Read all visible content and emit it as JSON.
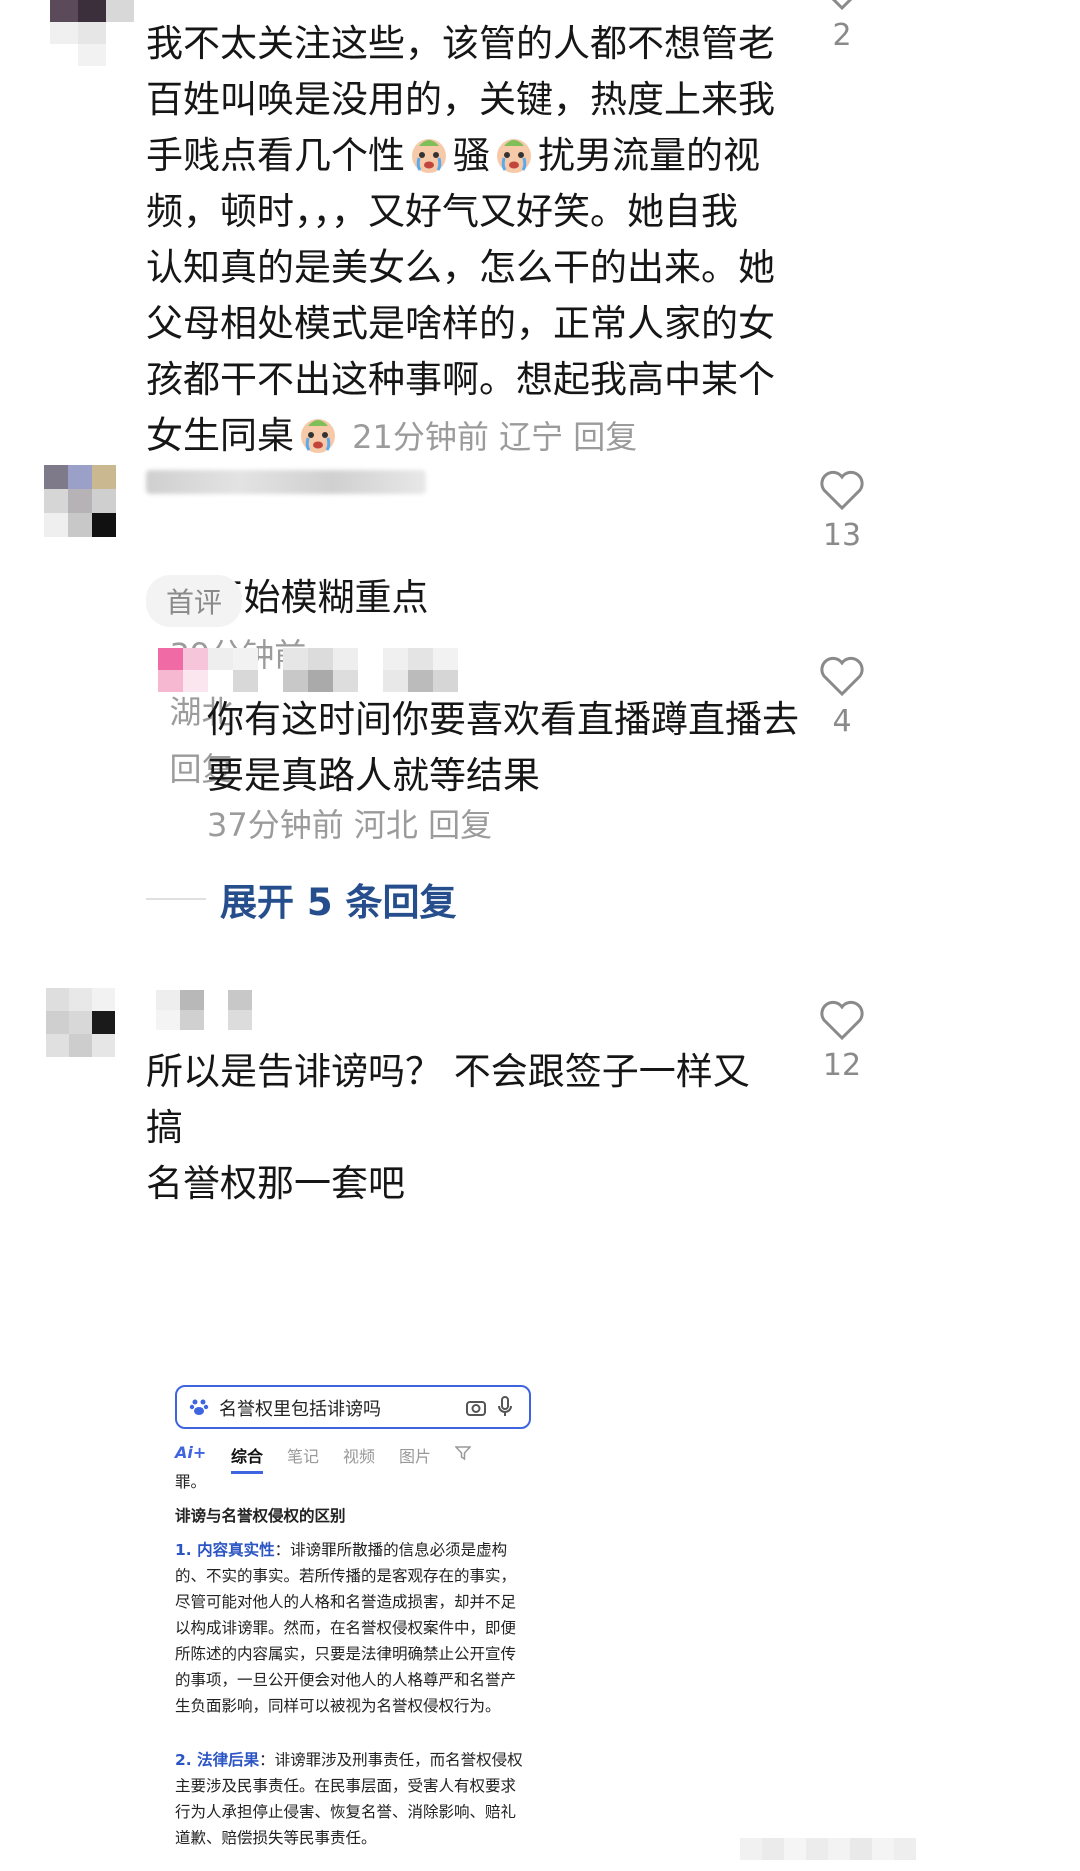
{
  "comments": [
    {
      "text": "我不太关注这些，该管的人都不想管老\n百姓叫唤是没用的，关键，热度上来我\n手贱点看几个性{e}骚{e}扰男流量的视\n频，顿时，，，又好气又好笑。她自我\n认知真的是美女么，怎么干的出来。她\n父母相处模式是啥样的，正常人家的女\n孩都干不出这种事啊。想起我高中某个\n女生同桌{e}",
      "time": "21分钟前",
      "region": "辽宁",
      "reply": "回复",
      "likes": "2"
    },
    {
      "text": "又开始模糊重点",
      "time": "39分钟前",
      "region": "湖北",
      "reply": "回复",
      "likes": "13",
      "tag": "首评"
    },
    {
      "text": "你有这时间你要喜欢看直播蹲直播去\n要是真路人就等结果",
      "time": "37分钟前",
      "region": "河北",
      "reply": "回复",
      "likes": "4"
    },
    {
      "text": "所以是告诽谤吗？ 不会跟签子一样又搞\n名誉权那一套吧",
      "likes": "12"
    }
  ],
  "expand_replies": "展开 5 条回复",
  "embedded": {
    "query": "名誉权里包括诽谤吗",
    "tabs": [
      "Ai+",
      "综合",
      "笔记",
      "视频",
      "图片"
    ],
    "lead": "罪。",
    "heading": "诽谤与名誉权侵权的区别",
    "p1_label": "1. 内容真实性",
    "p1": "：诽谤罪所散播的信息必须是虚构的、不实的事实。若所传播的是客观存在的事实，尽管可能对他人的人格和名誉造成损害，却并不足以构成诽谤罪。然而，在名誉权侵权案件中，即便所陈述的内容属实，只要是法律明确禁止公开宣传的事项，一旦公开便会对他人的人格尊严和名誉产生负面影响，同样可以被视为名誉权侵权行为。",
    "p2_label": "2. 法律后果",
    "p2": "：诽谤罪涉及刑事责任，而名誉权侵权主要涉及民事责任。在民事层面，受害人有权要求行为人承担停止侵害、恢复名誉、消除影响、赔礼道歉、赔偿损失等民事责任。"
  },
  "colors": {
    "link": "#264e8c",
    "meta": "#9b9b9b",
    "accent": "#3f64e0"
  }
}
